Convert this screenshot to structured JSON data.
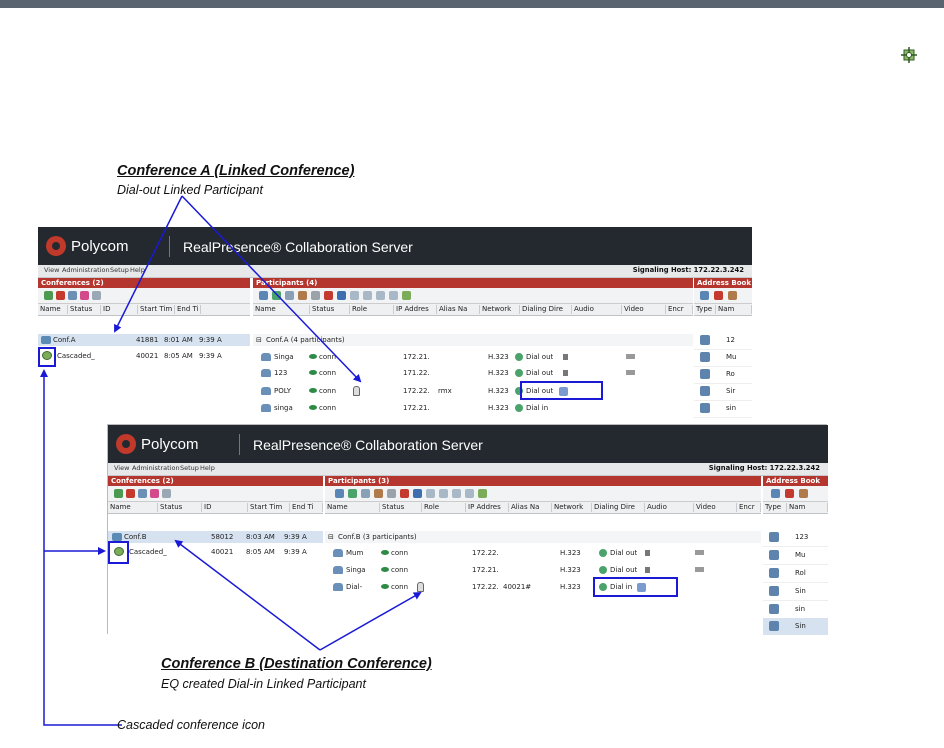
{
  "annotations": {
    "conf_a_heading": "Conference A (Linked Conference)",
    "conf_a_sub": "Dial-out Linked Participant",
    "conf_b_heading": "Conference B (Destination Conference)",
    "conf_b_sub": "EQ created Dial-in Linked Participant",
    "cascade_label": "Cascaded conference icon"
  },
  "icons": {
    "corner": "cascade-link-icon"
  },
  "colors": {
    "header": "#23292f",
    "pane_bar": "#b4362e",
    "highlight": "#1a1ad6",
    "arrow": "#1a1ad6"
  },
  "window_a": {
    "brand": "Polycom",
    "product": "RealPresence® Collaboration Server",
    "menu": [
      "View",
      "Administration",
      "Setup",
      "Help"
    ],
    "signaling": "Signaling Host: 172.22.3.242",
    "conferences_title": "Conferences (2)",
    "participants_title": "Participants (4)",
    "address_book_title": "Address Book",
    "conf_columns": [
      "Name",
      "Status",
      "ID",
      "Start Tim",
      "End Ti"
    ],
    "conferences": [
      {
        "name": "Conf.A",
        "status": "",
        "id": "41881",
        "start": "8:01 AM",
        "end": "9:39 A"
      },
      {
        "name": "Cascaded_",
        "status": "",
        "id": "40021",
        "start": "8:05 AM",
        "end": "9:39 A"
      }
    ],
    "part_columns": [
      "Name",
      "Status",
      "Role",
      "IP Addres",
      "Alias Na",
      "Network",
      "Dialing Dire",
      "Audio",
      "Video",
      "Encr"
    ],
    "group_label": "Conf.A (4 participants)",
    "participants": [
      {
        "name": "Singa",
        "status": "conn",
        "ip": "172.21.",
        "alias": "",
        "network": "H.323",
        "dial": "Dial out"
      },
      {
        "name": "123",
        "status": "conn",
        "ip": "171.22.",
        "alias": "",
        "network": "H.323",
        "dial": "Dial out"
      },
      {
        "name": "POLY",
        "status": "conn",
        "ip": "172.22.",
        "alias": "rmx",
        "network": "H.323",
        "dial": "Dial out"
      },
      {
        "name": "singa",
        "status": "conn",
        "ip": "172.21.",
        "alias": "",
        "network": "H.323",
        "dial": "Dial in"
      }
    ],
    "ab_columns": [
      "Type",
      "Nam"
    ],
    "address_book": [
      "12",
      "Mu",
      "Ro",
      "Sir",
      "sin"
    ]
  },
  "window_b": {
    "brand": "Polycom",
    "product": "RealPresence® Collaboration Server",
    "menu": [
      "View",
      "Administration",
      "Setup",
      "Help"
    ],
    "signaling": "Signaling Host: 172.22.3.242",
    "conferences_title": "Conferences (2)",
    "participants_title": "Participants (3)",
    "address_book_title": "Address Book",
    "conf_columns": [
      "Name",
      "Status",
      "ID",
      "Start Tim",
      "End Ti"
    ],
    "conferences": [
      {
        "name": "Conf.B",
        "status": "",
        "id": "58012",
        "start": "8:03 AM",
        "end": "9:39 A"
      },
      {
        "name": "Cascaded_",
        "status": "",
        "id": "40021",
        "start": "8:05 AM",
        "end": "9:39 A"
      }
    ],
    "part_columns": [
      "Name",
      "Status",
      "Role",
      "IP Addres",
      "Alias Na",
      "Network",
      "Dialing Dire",
      "Audio",
      "Video",
      "Encr"
    ],
    "group_label": "Conf.B (3 participants)",
    "participants": [
      {
        "name": "Mum",
        "status": "conn",
        "ip": "172.22.",
        "alias": "",
        "network": "H.323",
        "dial": "Dial out"
      },
      {
        "name": "Singa",
        "status": "conn",
        "ip": "172.21.",
        "alias": "",
        "network": "H.323",
        "dial": "Dial out"
      },
      {
        "name": "Dial-",
        "status": "conn",
        "ip": "172.22.",
        "alias": "40021#",
        "network": "H.323",
        "dial": "Dial in"
      }
    ],
    "ab_columns": [
      "Type",
      "Nam"
    ],
    "address_book": [
      "123",
      "Mu",
      "Rol",
      "Sin",
      "sin",
      "Sin"
    ]
  }
}
